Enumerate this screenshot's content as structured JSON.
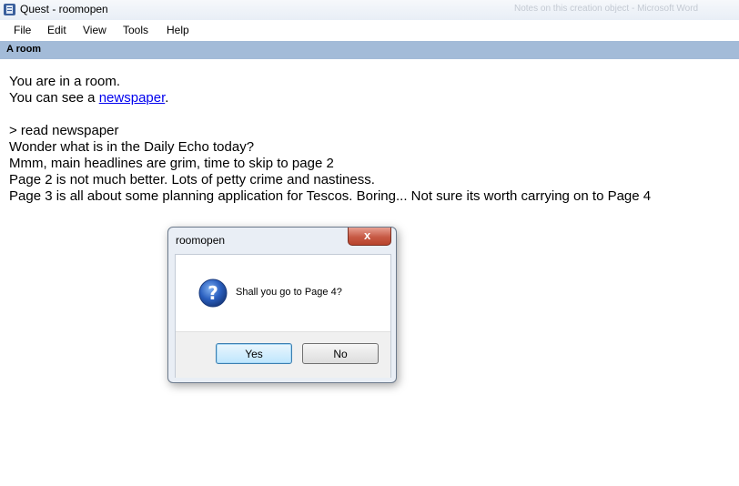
{
  "window": {
    "title": "Quest - roomopen",
    "background_ghost_text": [
      "Notes on this creation object - Microsoft Word"
    ]
  },
  "menubar": {
    "items": [
      {
        "label": "File"
      },
      {
        "label": "Edit"
      },
      {
        "label": "View"
      },
      {
        "label": "Tools"
      },
      {
        "label": "Help"
      }
    ]
  },
  "location": {
    "label": "A room"
  },
  "output": {
    "line1": "You are in a room.",
    "line2_prefix": "You can see a ",
    "line2_link": "newspaper",
    "line2_suffix": ".",
    "line3": "> read newspaper",
    "line4": "Wonder what is in the Daily Echo today?",
    "line5": "Mmm, main headlines are grim, time to skip to page 2",
    "line6": "Page 2 is not much better. Lots of petty crime and nastiness.",
    "line7": "Page 3 is all about some planning application for Tescos. Boring... Not sure its worth carrying on to Page 4"
  },
  "dialog": {
    "title": "roomopen",
    "close_label": "x",
    "icon": "question-icon",
    "message": "Shall you go to Page 4?",
    "yes_label": "Yes",
    "no_label": "No"
  },
  "colors": {
    "location_bar": "#a3bbd8",
    "link": "#0000ee",
    "close_button": "#c75a45",
    "question_icon": "#1f4fa8"
  }
}
